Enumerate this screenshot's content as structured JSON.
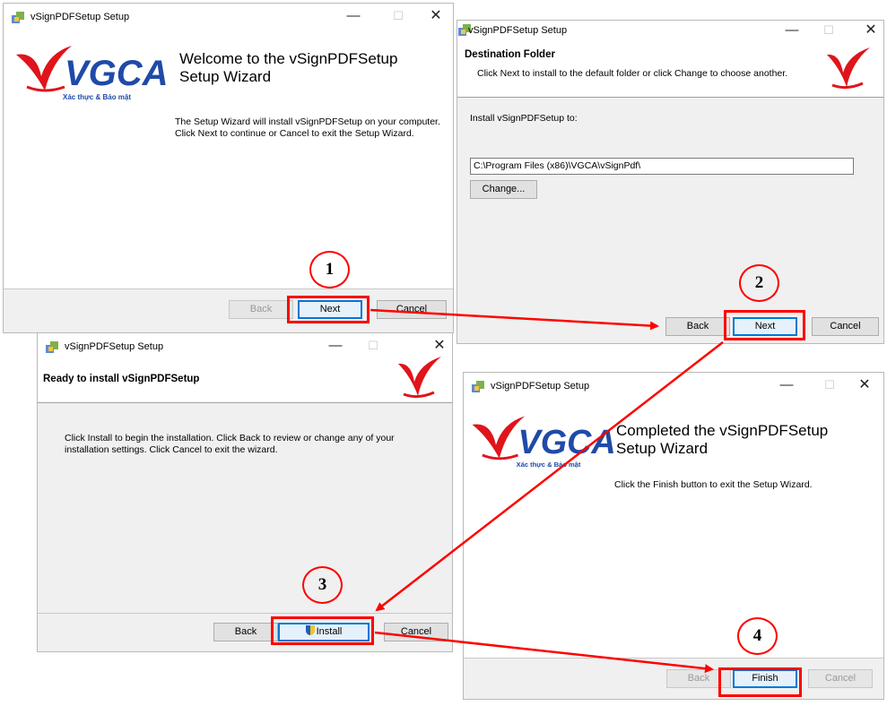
{
  "common": {
    "window_title": "vSignPDFSetup Setup",
    "minimize_glyph": "—",
    "maximize_glyph": "☐",
    "close_glyph": "✕",
    "logo_text": "VGCA",
    "logo_tagline": "Xác thực & Bảo mật"
  },
  "welcome": {
    "heading": "Welcome to the vSignPDFSetup Setup Wizard",
    "body": "The Setup Wizard will install vSignPDFSetup on your computer. Click Next to continue or Cancel to exit the Setup Wizard.",
    "back_label": "Back",
    "next_label": "Next",
    "cancel_label": "Cancel"
  },
  "destination": {
    "heading": "Destination Folder",
    "subheading": "Click Next to install to the default folder or click Change to choose another.",
    "install_to_label": "Install vSignPDFSetup to:",
    "path_value": "C:\\Program Files (x86)\\VGCA\\vSignPdf\\",
    "change_label": "Change...",
    "back_label": "Back",
    "next_label": "Next",
    "cancel_label": "Cancel"
  },
  "ready": {
    "heading": "Ready to install vSignPDFSetup",
    "body": "Click Install to begin the installation. Click Back to review or change any of your installation settings. Click Cancel to exit the wizard.",
    "back_label": "Back",
    "install_label": "Install",
    "cancel_label": "Cancel"
  },
  "completed": {
    "heading": "Completed the vSignPDFSetup Setup Wizard",
    "body": "Click the Finish button to exit the Setup Wizard.",
    "back_label": "Back",
    "finish_label": "Finish",
    "cancel_label": "Cancel"
  },
  "steps": [
    "1",
    "2",
    "3",
    "4"
  ],
  "colors": {
    "annotation": "#ff0000",
    "default_button_border": "#0078d7",
    "logo_red": "#e0141b",
    "logo_blue": "#1f4aa8"
  }
}
